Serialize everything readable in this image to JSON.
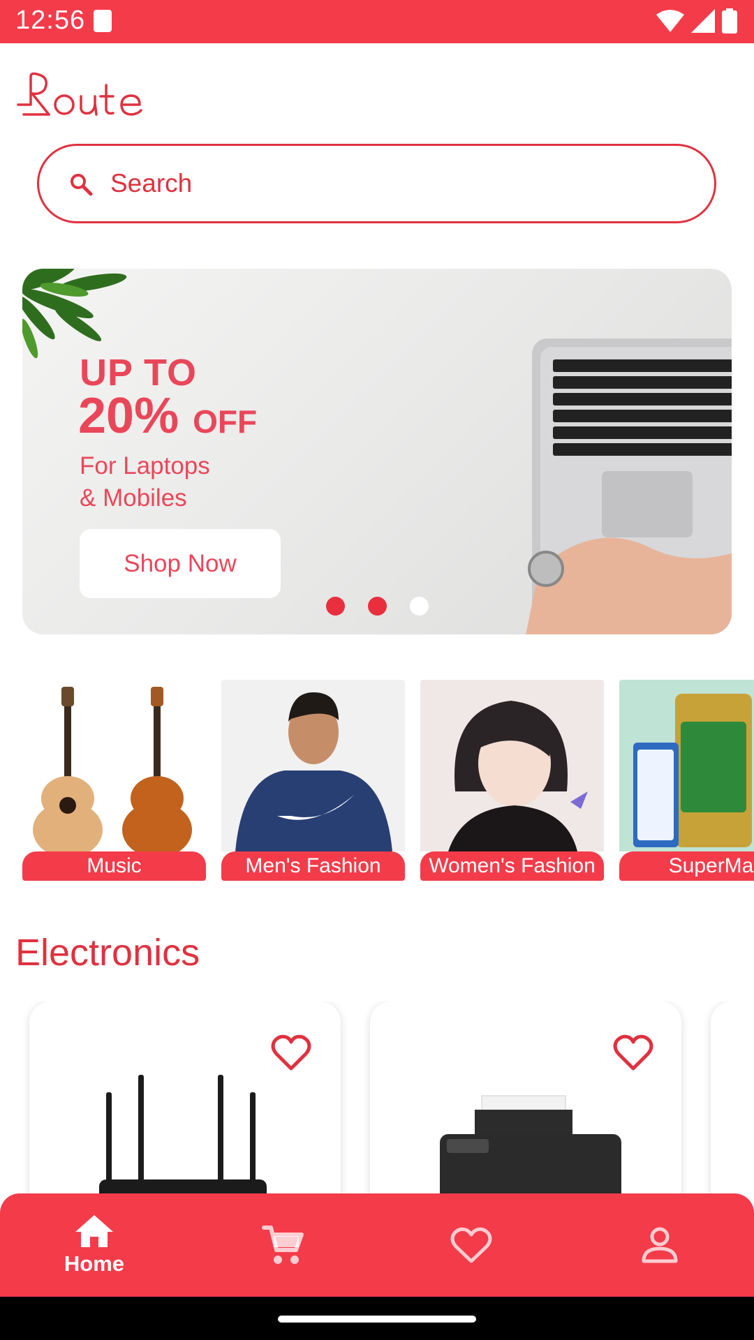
{
  "status_bar": {
    "time": "12:56"
  },
  "colors": {
    "brand": "#f43b4a",
    "banner_text": "#e94759",
    "dot": "#e92f3e"
  },
  "header": {
    "logo_text": "Route"
  },
  "search": {
    "placeholder": "Search",
    "icon": "search-icon"
  },
  "banner": {
    "line1": "UP TO",
    "percent": "20%",
    "off": "OFF",
    "line3a": "For Laptops",
    "line3b": "& Mobiles",
    "button": "Shop Now",
    "dots_total": 3,
    "dots_active_index": 2
  },
  "categories": [
    {
      "label": "Music"
    },
    {
      "label": "Men's Fashion"
    },
    {
      "label": "Women's Fashion"
    },
    {
      "label": "SuperMa"
    }
  ],
  "section": {
    "title": "Electronics"
  },
  "products": [
    {
      "image": "router",
      "favorite_icon": "heart-outline-icon"
    },
    {
      "image": "printer",
      "favorite_icon": "heart-outline-icon"
    }
  ],
  "bottom_nav": [
    {
      "icon": "home-icon",
      "label": "Home",
      "active": true
    },
    {
      "icon": "cart-icon",
      "label": "",
      "active": false
    },
    {
      "icon": "heart-icon",
      "label": "",
      "active": false
    },
    {
      "icon": "profile-icon",
      "label": "",
      "active": false
    }
  ]
}
